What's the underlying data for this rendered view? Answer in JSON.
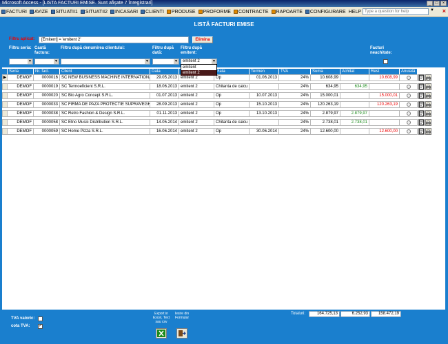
{
  "window": {
    "title": "Microsoft Access - [LISTA FACTURI EMISE. Sunt afișate 7 înregistrari]"
  },
  "menu": {
    "items": [
      {
        "label": "FACTURI"
      },
      {
        "label": "AVIZE"
      },
      {
        "label": "SITUATII1"
      },
      {
        "label": "SITUATII2"
      },
      {
        "label": "INCASARI"
      },
      {
        "label": "CLIENTI"
      },
      {
        "label": "PRODUSE"
      },
      {
        "label": "PROFORME"
      },
      {
        "label": "CONTRACTE"
      },
      {
        "label": "RAPOARTE"
      },
      {
        "label": "CONFIGURARE"
      },
      {
        "label": "HELP"
      }
    ],
    "question_placeholder": "Type a question for help"
  },
  "page_title": "LISTĂ FACTURI EMISE",
  "filter": {
    "label": "Filtru aplicat:",
    "value": "[Emitent] = 'emitent 2'",
    "clear_button": "Elimina"
  },
  "filters": {
    "seria_label": "Filtru seria:",
    "cauta_label": "Caută factura:",
    "client_label": "Filtru după denumirea clientului:",
    "data_label": "Filtru după dată:",
    "emitent_label": "Filtru după emitent:",
    "neachitate_label": "Facturi neachitate:",
    "emitent_value": "emitent 2",
    "emitent_options": [
      "emitent",
      "emitent 2"
    ]
  },
  "table": {
    "headers": [
      "Seria",
      "Nr. fact.",
      "Client",
      "Data",
      "Plata",
      "Termen",
      "TVA",
      "Suma",
      "Achitat",
      "Rest",
      "Anulată"
    ],
    "rows": [
      {
        "seria": "DEMOF",
        "nr": "0000016",
        "client": "SC NEW BUSINESS MACHINE INTERNATIONAL",
        "data": "29.05.2013",
        "emitent": "emitent 2",
        "plata": "Op",
        "termen": "01.06.2013",
        "tva": "24%",
        "suma": "10.608,99",
        "achitat": "",
        "rest": "10.608,99"
      },
      {
        "seria": "DEMOF",
        "nr": "0000019",
        "client": "SC Termoeficient S.R.L.",
        "data": "18.06.2013",
        "emitent": "emitent 2",
        "plata": "Chitanta de calcu",
        "termen": "",
        "tva": "24%",
        "suma": "634,95",
        "achitat": "634,95",
        "rest": ""
      },
      {
        "seria": "DEMOF",
        "nr": "0000020",
        "client": "SC Bio Agro Concept S.R.L.",
        "data": "01.07.2013",
        "emitent": "emitent 2",
        "plata": "Op",
        "termen": "10.07.2013",
        "tva": "24%",
        "suma": "15.000,01",
        "achitat": "",
        "rest": "15.000,01"
      },
      {
        "seria": "DEMOF",
        "nr": "0000033",
        "client": "SC FIRMA DE PAZA PROTECTIE SUPRAVEGHER",
        "data": "28.09.2013",
        "emitent": "emitent 2",
        "plata": "Op",
        "termen": "15.10.2013",
        "tva": "24%",
        "suma": "120.263,19",
        "achitat": "",
        "rest": "120.263,19"
      },
      {
        "seria": "DEMOF",
        "nr": "0000038",
        "client": "SC Retro Fashion & Design S.R.L.",
        "data": "01.11.2013",
        "emitent": "emitent 2",
        "plata": "Op",
        "termen": "13.10.2013",
        "tva": "24%",
        "suma": "2.879,97",
        "achitat": "2.879,97",
        "rest": ""
      },
      {
        "seria": "DEMOF",
        "nr": "0000058",
        "client": "SC Etno Music Distribution S.R.L.",
        "data": "14.05.2014",
        "emitent": "emitent 2",
        "plata": "Chitanta de calcu",
        "termen": "",
        "tva": "24%",
        "suma": "2.738,01",
        "achitat": "2.738,01",
        "rest": ""
      },
      {
        "seria": "DEMOF",
        "nr": "0000059",
        "client": "SC Home Pizza S.R.L.",
        "data": "16.06.2014",
        "emitent": "emitent 2",
        "plata": "Op",
        "termen": "30.06.2014",
        "tva": "24%",
        "suma": "12.600,00",
        "achitat": "",
        "rest": "12.600,00"
      }
    ]
  },
  "totals": {
    "label": "Totaluri:",
    "suma": "164.725,13",
    "achitat": "6.252,93",
    "rest": "158.472,19"
  },
  "footer": {
    "tva_valoric": "TVA valoric:",
    "cota_tva": "cota TVA:",
    "cota_tva_checked": true,
    "export_line1": "Export in",
    "export_line2": "Excel, Text",
    "export_line3": "sau csv",
    "exit_line1": "Iesire din",
    "exit_line2": "Formular"
  },
  "colors": {
    "accent": "#1a7fce",
    "red": "#e00000",
    "green": "#1a8a1a"
  }
}
